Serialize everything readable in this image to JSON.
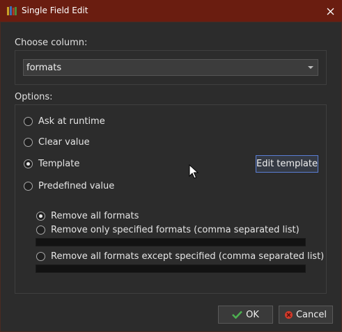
{
  "window": {
    "title": "Single Field Edit"
  },
  "choose_column": {
    "label": "Choose column:",
    "value": "formats"
  },
  "options": {
    "label": "Options:",
    "radios": [
      {
        "label": "Ask at runtime",
        "checked": false
      },
      {
        "label": "Clear value",
        "checked": false
      },
      {
        "label": "Template",
        "checked": true
      },
      {
        "label": "Predefined value",
        "checked": false
      }
    ],
    "edit_template_label": "Edit template",
    "sub_radios": [
      {
        "label": "Remove all formats",
        "checked": true
      },
      {
        "label": "Remove only specified formats (comma separated list)",
        "checked": false,
        "field_value": ""
      },
      {
        "label": "Remove all formats except specified (comma separated list)",
        "checked": false,
        "field_value": ""
      }
    ]
  },
  "buttons": {
    "ok": "OK",
    "cancel": "Cancel"
  },
  "colors": {
    "titlebar": "#6a1d10",
    "ok_check": "#4caf50",
    "cancel_x": "#d23a2a"
  }
}
